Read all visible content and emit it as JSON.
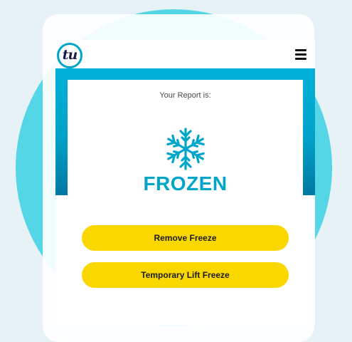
{
  "header": {
    "logo_text": "tu",
    "menu_icon": "hamburger-menu-icon"
  },
  "report": {
    "label": "Your Report is:",
    "status": "FROZEN",
    "status_icon": "snowflake-icon"
  },
  "actions": {
    "remove_label": "Remove Freeze",
    "temporary_lift_label": "Temporary Lift Freeze"
  },
  "colors": {
    "brand_cyan": "#00a6ca",
    "button_yellow": "#fbd700",
    "circle_bg": "#55d6e6",
    "page_bg": "#e6f2f6"
  }
}
